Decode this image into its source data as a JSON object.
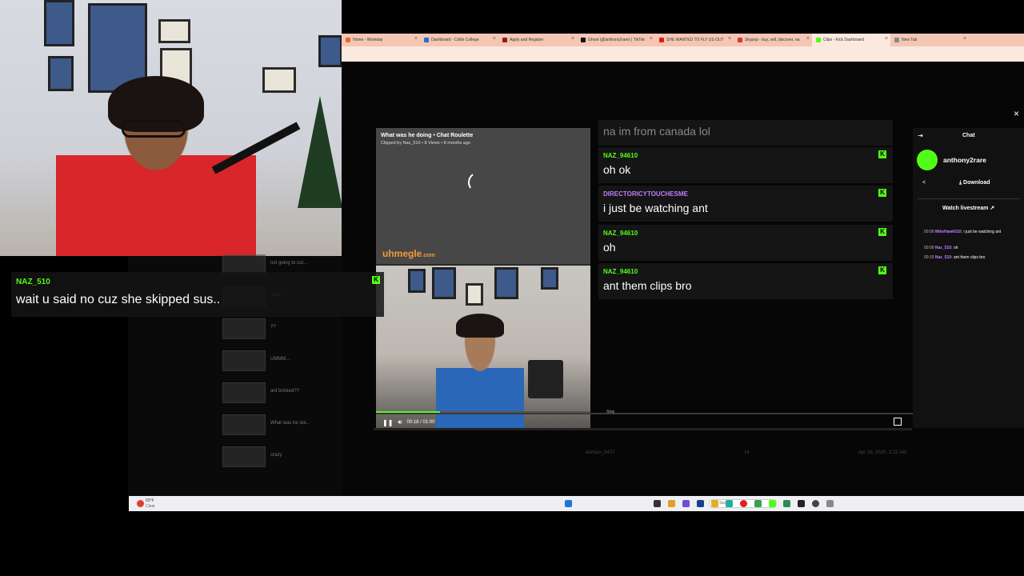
{
  "browser": {
    "tabs": [
      {
        "label": "Home - Workday",
        "color": "#e36b2c"
      },
      {
        "label": "Dashboard - Collin College",
        "color": "#2a6ad8"
      },
      {
        "label": "Apply and Register",
        "color": "#8e1b1b"
      },
      {
        "label": "Ghost (@anthony2rare) | TikTok",
        "color": "#111111"
      },
      {
        "label": "SHE WANTED TO FLY US OUT",
        "color": "#e11b1b"
      },
      {
        "label": "Skypop - buy, sell, discover, ea",
        "color": "#d23c3c"
      },
      {
        "label": "Clips - Kick Dashboard",
        "color": "#53fc18"
      },
      {
        "label": "New Tab",
        "color": "#888888"
      }
    ],
    "close_glyph": "×"
  },
  "overlay_chat": {
    "username": "NAZ_510",
    "message": "wait u said no cuz she skipped sus.."
  },
  "video": {
    "title": "What was he doing • Chat Roulette",
    "meta": "Clipped by Naz_510 • 8 Views • 8 months ago",
    "watermark": "uhmegle",
    "watermark_domain": ".com",
    "time": "00:18 / 01:00",
    "progress": 0.3,
    "dark_overlay_label": "Stop"
  },
  "clip_list": [
    {
      "title": "not going to cut..."
    },
    {
      "title": "uhoh"
    },
    {
      "title": "??"
    },
    {
      "title": "UMMM..."
    },
    {
      "title": "ant bricked??"
    },
    {
      "title": "What was he doi..."
    },
    {
      "title": "crazy"
    }
  ],
  "table_row": {
    "user": "damian_5437",
    "views": "14",
    "date": "Apr 28, 2025, 3:22 AM"
  },
  "chat_messages": [
    {
      "user": "",
      "text": "na im from canada lol",
      "color": "#ffffff"
    },
    {
      "user": "NAZ_94610",
      "text": "oh ok",
      "color": "#53fc18"
    },
    {
      "user": "DIRECTORICYTOUCHESME",
      "text": "i just be watching ant",
      "color": "#c07cff"
    },
    {
      "user": "NAZ_94610",
      "text": "oh",
      "color": "#53fc18"
    },
    {
      "user": "NAZ_94610",
      "text": "ant them clips bro",
      "color": "#53fc18"
    }
  ],
  "sidebar": {
    "title": "Chat",
    "channel": "anthony2rare",
    "download": "Download",
    "watch_livestream": "Watch livestream",
    "log": [
      {
        "time": "00:09",
        "user": "MikeHawk010:",
        "text": "i just be watching ant"
      },
      {
        "time": "00:09",
        "user": "Naz_510:",
        "text": "oh"
      },
      {
        "time": "00:15",
        "user": "Naz_510:",
        "text": "ant them clips bro"
      }
    ]
  },
  "taskbar": {
    "weather": "63°F",
    "weather_desc": "Clear",
    "search_placeholder": "Search"
  }
}
